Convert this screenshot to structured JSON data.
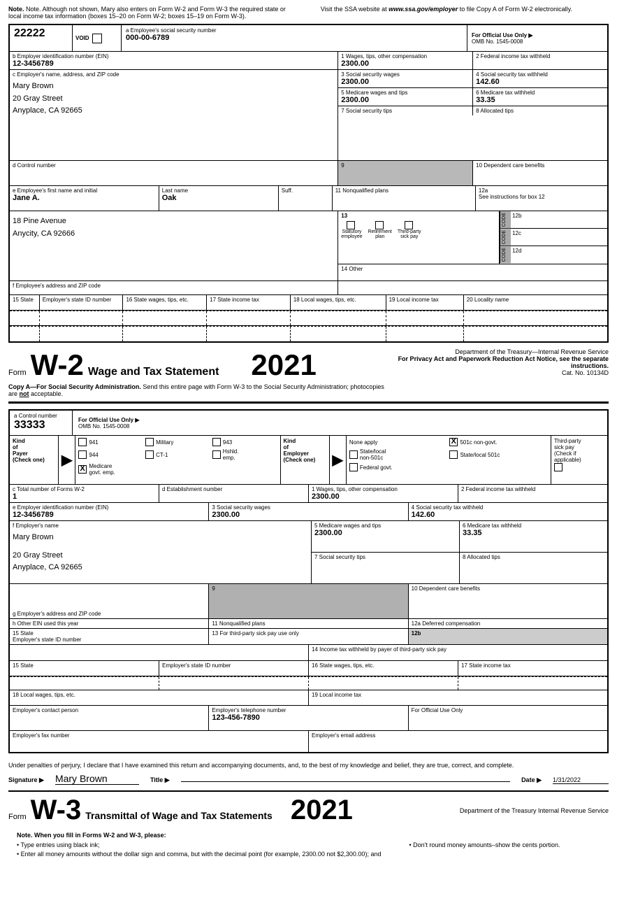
{
  "top_note": {
    "left": "Note. Although not shown, Mary also enters on Form W-2 and Form W-3 the required state or local income tax information (boxes 15–20 on Form W-2; boxes 15–19 on Form W-3).",
    "right_prefix": "Visit the SSA website at ",
    "right_url": "www.ssa.gov/employer",
    "right_suffix": " to file Copy A of Form W-2 electronically."
  },
  "w2": {
    "control_number": "22222",
    "void_label": "VOID",
    "ssn_label": "a Employee's social security number",
    "ssn_value": "000-00-6789",
    "official_label": "For Official Use Only ▶",
    "omb": "OMB No. 1545-0008",
    "ein_label": "b Employer identification number (EIN)",
    "ein_value": "12-3456789",
    "employer_label": "c Employer's name, address, and ZIP code",
    "employer_name": "Mary Brown",
    "employer_addr1": "20 Gray Street",
    "employer_addr2": "Anyplace, CA 92665",
    "control_d_label": "d Control number",
    "emp_fname_label": "e Employee's first name and initial",
    "emp_fname": "Jane A.",
    "emp_lname_label": "Last name",
    "emp_lname": "Oak",
    "suff_label": "Suff.",
    "emp_addr_line1": "18 Pine Avenue",
    "emp_addr_line2": "Anycity, CA 92666",
    "emp_addr_label": "f Employee's address and ZIP code",
    "box1_label": "1  Wages, tips, other compensation",
    "box1_value": "2300.00",
    "box2_label": "2  Federal income tax withheld",
    "box2_value": "",
    "box3_label": "3  Social security wages",
    "box3_value": "2300.00",
    "box4_label": "4  Social security tax withheld",
    "box4_value": "142.60",
    "box5_label": "5  Medicare wages and tips",
    "box5_value": "2300.00",
    "box6_label": "6  Medicare tax withheld",
    "box6_value": "33.35",
    "box7_label": "7  Social security tips",
    "box7_value": "",
    "box8_label": "8  Allocated tips",
    "box8_value": "",
    "box9_label": "9",
    "box9_value": "",
    "box10_label": "10  Dependent care benefits",
    "box10_value": "",
    "box11_label": "11  Nonqualified plans",
    "box11_value": "",
    "box12a_label": "12a",
    "box12a_see": "See instructions for box 12",
    "box12b_label": "12b",
    "box12c_label": "12c",
    "box12d_label": "12d",
    "box13_label": "13",
    "box13_stat": "Statutory\nemployee",
    "box13_ret": "Retirement\nplan",
    "box13_3rd": "Third-party\nsick pay",
    "box14_label": "14  Other",
    "box14_value": "",
    "state15_label": "15  State",
    "state15b_label": "Employer's state ID number",
    "box16_label": "16  State wages, tips, etc.",
    "box17_label": "17  State income tax",
    "box18_label": "18  Local wages, tips, etc.",
    "box19_label": "19  Local income tax",
    "box20_label": "20  Locality name",
    "form_label": "Form",
    "w2_big": "W-2",
    "w2_title": "Wage and Tax Statement",
    "w2_year": "2021",
    "dept": "Department of the Treasury—Internal Revenue Service",
    "privacy": "For Privacy Act and Paperwork Reduction Act Notice, see the separate instructions.",
    "cat": "Cat. No. 10134D",
    "copy_a_text": "Copy A—For Social Security Administration.",
    "copy_a_rest": " Send this entire page with Form W-3 to the Social Security Administration; photocopies are ",
    "copy_a_not": "not",
    "copy_a_end": " acceptable."
  },
  "w3": {
    "control_label": "a  Control number",
    "control_value": "33333",
    "official_label": "For Official Use Only ▶",
    "omb": "OMB No. 1545-0008",
    "kind_payer_label": "Kind\nof\nPayer\n(Check one)",
    "payer_941": "941",
    "payer_military": "Military",
    "payer_943": "943",
    "payer_944": "944",
    "payer_ct1": "CT-1",
    "payer_hshld": "Hshld.\nemp.",
    "payer_medicare": "Medicare\ngovt. emp.",
    "payer_none": "None apply",
    "payer_501c": "501c non-govt.",
    "payer_state_local": "State/local\nnon-501c",
    "payer_state_local_501c": "State/local 501c",
    "payer_fed": "Federal govt.",
    "third_party_label": "Third-party\nsick pay\n(Check if\napplicable)",
    "kind_employer_label": "Kind\nof\nEmployer\n(Check one)",
    "total_forms_label": "c  Total number of Forms W-2",
    "total_forms_value": "1",
    "estab_label": "d  Establishment number",
    "ein_label": "e  Employer identification number (EIN)",
    "ein_value": "12-3456789",
    "employer_name_label": "f  Employer's name",
    "employer_name": "Mary Brown",
    "employer_addr1": "20 Gray Street",
    "employer_addr2": "Anyplace, CA 92665",
    "emp_addr_label": "g  Employer's address and ZIP code",
    "other_ein_label": "h  Other EIN used this year",
    "box1_label": "1  Wages, tips, other compensation",
    "box1_value": "2300.00",
    "box2_label": "2  Federal income tax withheld",
    "box2_value": "",
    "box3_label": "3  Social security wages",
    "box3_value": "2300.00",
    "box4_label": "4  Social security tax withheld",
    "box4_value": "142.60",
    "box5_label": "5  Medicare wages and tips",
    "box5_value": "2300.00",
    "box6_label": "6  Medicare tax withheld",
    "box6_value": "33.35",
    "box7_label": "7  Social security tips",
    "box7_value": "",
    "box8_label": "8  Allocated tips",
    "box8_value": "",
    "box9_label": "9",
    "box9_value": "",
    "box10_label": "10  Dependent care benefits",
    "box10_value": "",
    "box11_label": "11  Nonqualified plans",
    "box11_value": "",
    "box12a_label": "12a  Deferred compensation",
    "box12a_value": "",
    "box12b_label": "12b",
    "box12b_value": "",
    "box13_label": "13  For third-party sick pay use only",
    "box13_value": "",
    "box14_label": "14  Income tax withheld by payer of third-party sick pay",
    "box14_value": "",
    "state15_label": "15  State",
    "state15b_label": "Employer's state ID number",
    "box16_label": "16  State wages, tips, etc.",
    "box17_label": "17  State income tax",
    "box18_label": "18  Local wages, tips, etc.",
    "box19_label": "19  Local income tax",
    "contact_label": "Employer's contact person",
    "contact_value": "",
    "phone_label": "Employer's telephone number",
    "phone_value": "123-456-7890",
    "official_use_label": "For Official Use Only",
    "fax_label": "Employer's fax number",
    "fax_value": "",
    "email_label": "Employer's email address",
    "email_value": "",
    "penalty_text": "Under penalties of perjury, I declare that I have examined this return and accompanying documents, and, to the best of my knowledge and belief, they are true, correct, and complete.",
    "sig_label": "Signature ▶",
    "sig_value": "Mary Brown",
    "title_label": "Title ▶",
    "title_value": "",
    "date_label": "Date ▶",
    "date_value": "1/31/2022",
    "form_label": "Form",
    "w3_big": "W-3",
    "w3_title": "Transmittal of Wage and Tax Statements",
    "w3_year": "2021",
    "dept_right": "Department of the Treasury Internal Revenue Service"
  },
  "bottom_notes": {
    "title": "Note. When you fill in Forms W-2 and W-3, please:",
    "bullet1": "Type entries using black ink;",
    "bullet2": "Enter all money amounts without the dollar sign and comma, but with the decimal point (for example, 2300.00 not $2,300.00); and",
    "bullet3": "Don't round money amounts–show the cents portion."
  }
}
